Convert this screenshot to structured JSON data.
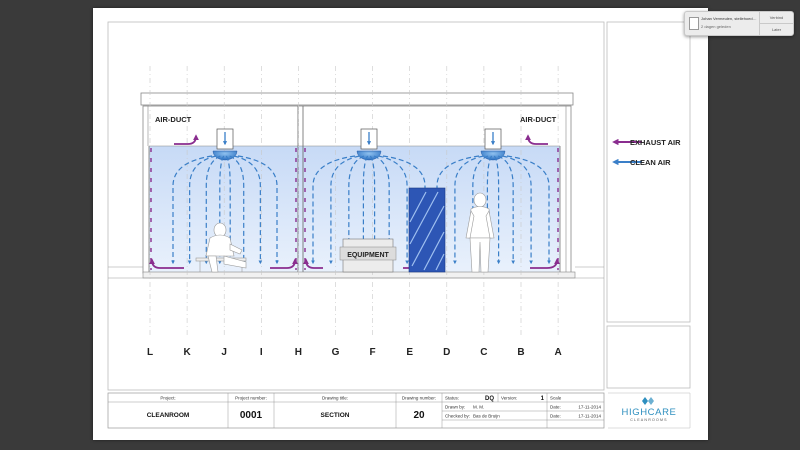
{
  "drawing": {
    "labels": {
      "air_duct_left": "AIR-DUCT",
      "air_duct_right": "AIR-DUCT",
      "equipment": "EQUIPMENT"
    },
    "legend": {
      "exhaust": "EXHAUST AIR",
      "clean": "CLEAN AIR"
    },
    "grid_axes": [
      "L",
      "K",
      "J",
      "I",
      "H",
      "G",
      "F",
      "E",
      "D",
      "C",
      "B",
      "A"
    ],
    "colors": {
      "exhaust": "#8a2d8f",
      "clean": "#3a7fc8",
      "clean_fill": "#cfe0f7",
      "glass": "#2d56b5"
    }
  },
  "title_block": {
    "project_label": "Project:",
    "project_value": "CLEANROOM",
    "project_number_label": "Project number:",
    "project_number_value": "0001",
    "drawing_title_label": "Drawing title:",
    "drawing_title_value": "SECTION",
    "drawing_number_label": "Drawing number:",
    "drawing_number_value": "20",
    "status_label": "Status:",
    "status_value": "DQ",
    "version_label": "Version:",
    "version_value": "1",
    "scale_label": "Scale",
    "drawn_by_label": "Drawn by:",
    "drawn_by_value": "M. M.",
    "checked_by_label": "Checked by:",
    "checked_by_value": "Bas de Bruijn",
    "date_label_1": "Date:",
    "date_value_1": "17-11-2014",
    "date_label_2": "Date:",
    "date_value_2": "17-11-2014",
    "logo_main": "HIGHCARE",
    "logo_sub": "CLEANROOMS"
  },
  "notification": {
    "text": "Johan Vermeulen, stellehoedezon…",
    "sub": "2 dagen geleden",
    "button_top": "Verbind",
    "button_bottom": "Later"
  }
}
